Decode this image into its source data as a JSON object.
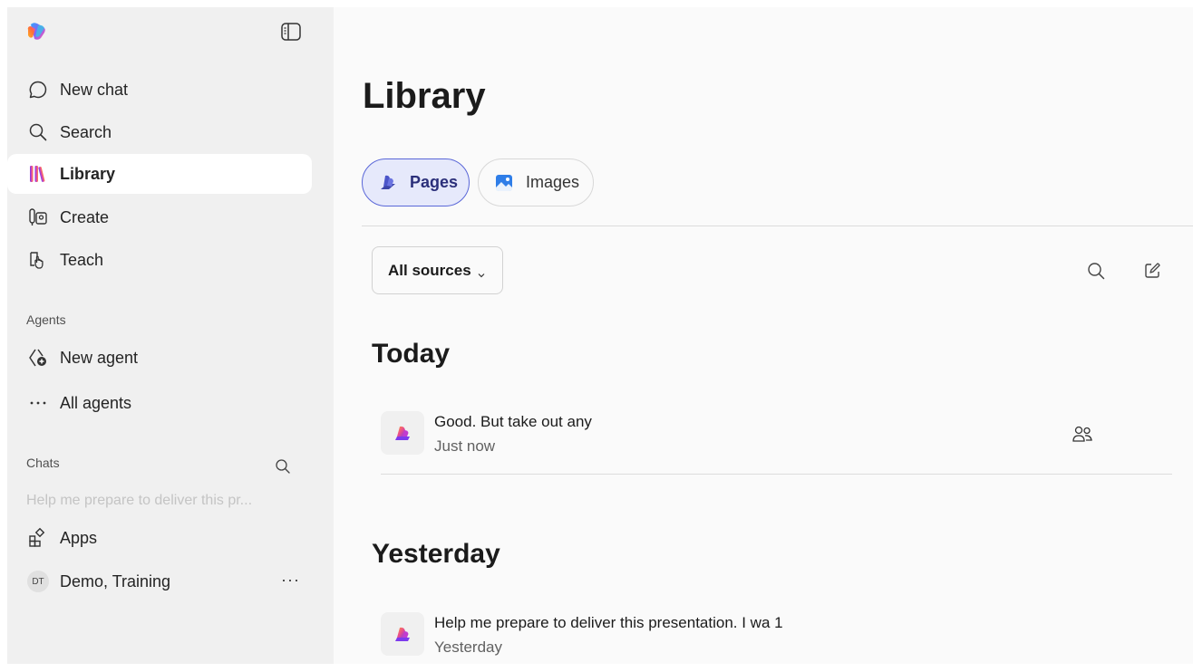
{
  "sidebar": {
    "nav": [
      {
        "label": "New chat",
        "icon": "chat-bubble-icon"
      },
      {
        "label": "Search",
        "icon": "search-icon"
      },
      {
        "label": "Library",
        "icon": "library-icon",
        "active": true
      },
      {
        "label": "Create",
        "icon": "create-icon"
      },
      {
        "label": "Teach",
        "icon": "teach-icon"
      }
    ],
    "agents_label": "Agents",
    "agents": [
      {
        "label": "New agent",
        "icon": "new-agent-icon"
      },
      {
        "label": "All agents",
        "icon": "more-dots-icon"
      }
    ],
    "chats_label": "Chats",
    "recent_chat": "Help me prepare to deliver this pr...",
    "apps_label": "Apps",
    "user": {
      "initials": "DT",
      "name": "Demo, Training",
      "more": "···"
    }
  },
  "main": {
    "title": "Library",
    "tabs": [
      {
        "label": "Pages",
        "active": true
      },
      {
        "label": "Images",
        "active": false
      }
    ],
    "filter": {
      "label": "All sources"
    },
    "groups": [
      {
        "title": "Today",
        "items": [
          {
            "title": "Good. But take out any",
            "subtitle": "Just now",
            "shared": true
          }
        ]
      },
      {
        "title": "Yesterday",
        "items": [
          {
            "title": "Help me prepare to deliver this presentation. I wa 1",
            "subtitle": "Yesterday",
            "shared": false
          }
        ]
      }
    ]
  },
  "colors": {
    "accent": "#5a67d8",
    "active_tab_bg": "#e6e9fb",
    "sidebar_bg": "#f0f0f0",
    "main_bg": "#fafafa"
  }
}
